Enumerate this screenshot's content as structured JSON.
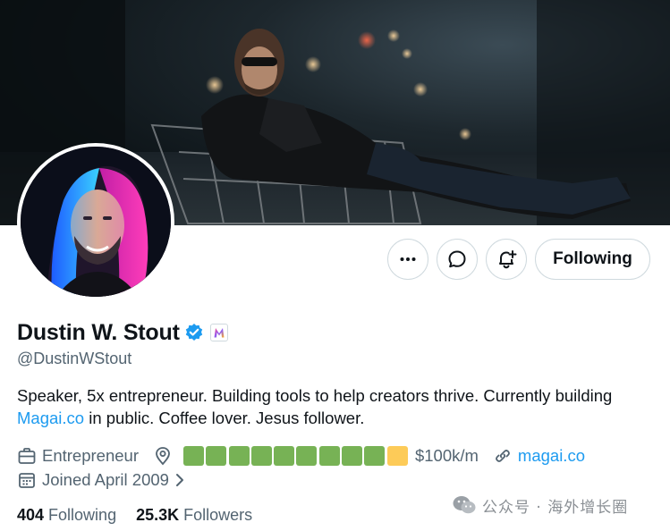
{
  "profile": {
    "display_name": "Dustin W. Stout",
    "handle": "@DustinWStout",
    "bio_text_1": "Speaker, 5x entrepreneur. Building tools to help creators thrive. Currently building ",
    "bio_link": "Magai.co",
    "bio_text_2": " in public. Coffee lover. Jesus follower.",
    "verified_icon": "verified-badge-icon",
    "affiliate_icon": "magai-logo-icon"
  },
  "actions": {
    "more_icon": "more-icon",
    "message_icon": "message-icon",
    "notify_icon": "bell-plus-icon",
    "following_label": "Following"
  },
  "meta": {
    "profession": "Entrepreneur",
    "location_squares": [
      "green",
      "green",
      "green",
      "green",
      "green",
      "green",
      "green",
      "green",
      "green",
      "yellow"
    ],
    "location_suffix": "$100k/m",
    "website": "magai.co",
    "joined": "Joined April 2009"
  },
  "stats": {
    "following_count": "404",
    "following_label": "Following",
    "followers_count": "25.3K",
    "followers_label": "Followers"
  },
  "watermark": {
    "text": "公众号 · 海外增长圈",
    "icon": "wechat-icon"
  },
  "colors": {
    "accent": "#1d9bf0",
    "square_green": "#77b255",
    "square_yellow": "#fdcb58",
    "text_secondary": "#536471"
  }
}
